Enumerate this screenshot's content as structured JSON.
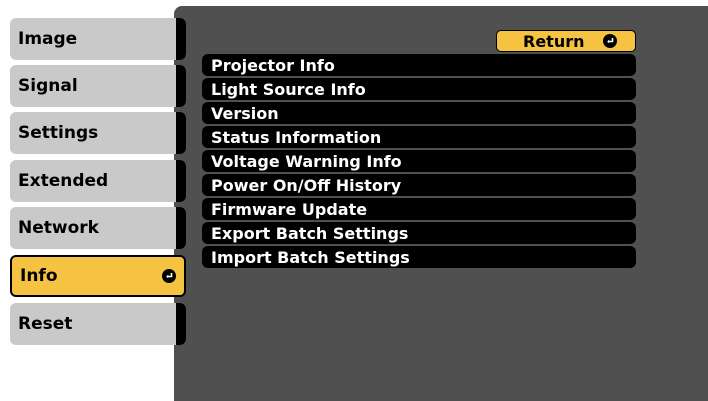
{
  "sidebar": {
    "items": [
      {
        "label": "Image",
        "active": false
      },
      {
        "label": "Signal",
        "active": false
      },
      {
        "label": "Settings",
        "active": false
      },
      {
        "label": "Extended",
        "active": false
      },
      {
        "label": "Network",
        "active": false
      },
      {
        "label": "Info",
        "active": true,
        "icon": "enter-icon"
      },
      {
        "label": "Reset",
        "active": false
      }
    ]
  },
  "panel": {
    "return_label": "Return",
    "return_icon": "enter-icon",
    "items": [
      "Projector Info",
      "Light Source Info",
      "Version",
      "Status Information",
      "Voltage Warning Info",
      "Power On/Off History",
      "Firmware Update",
      "Export Batch Settings",
      "Import Batch Settings"
    ]
  },
  "colors": {
    "panel_bg": "#505050",
    "button_bg": "#c9c9c9",
    "accent": "#f5c242",
    "item_bg": "#000000",
    "item_text": "#ffffff"
  }
}
